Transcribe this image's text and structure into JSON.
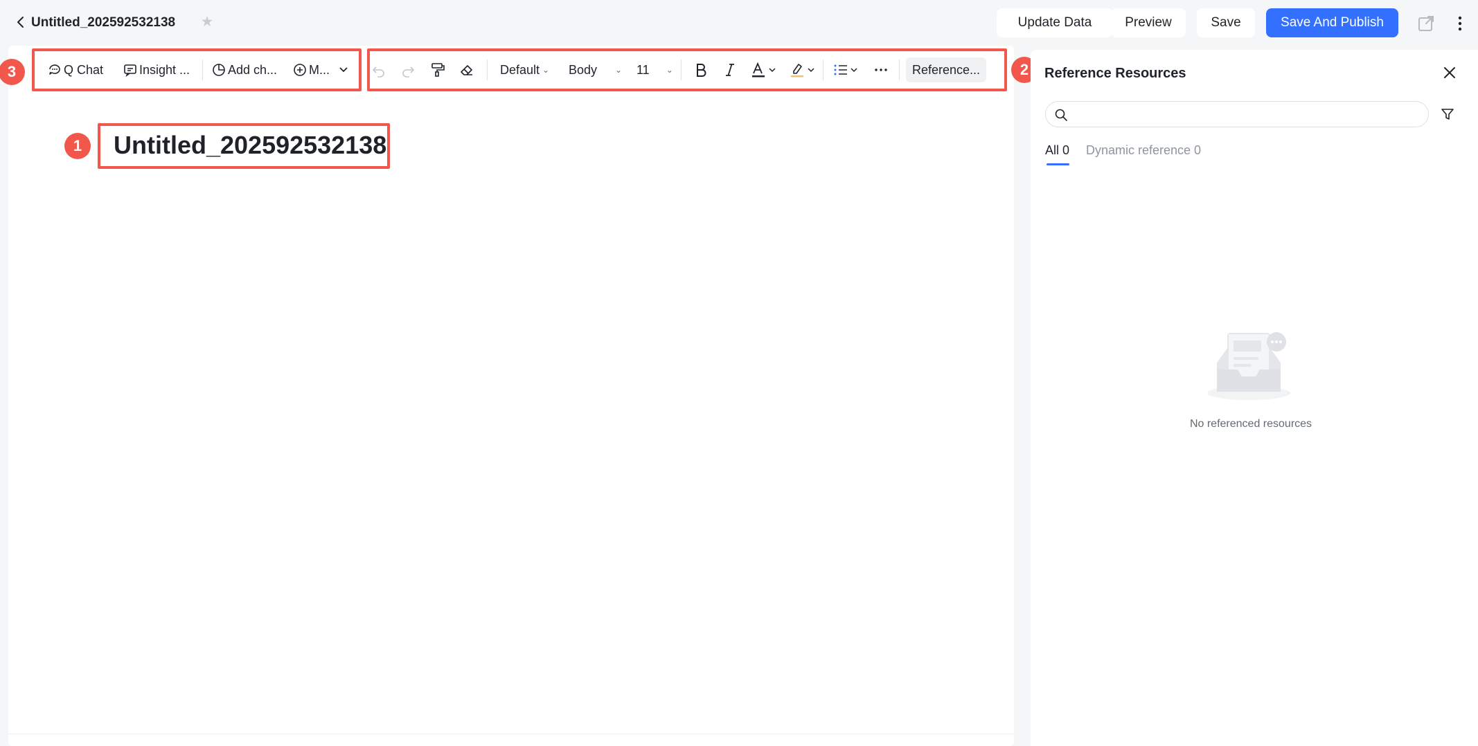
{
  "header": {
    "title": "Untitled_202592532138",
    "buttons": {
      "update_data": "Update Data",
      "preview": "Preview",
      "save": "Save",
      "save_publish": "Save And Publish"
    }
  },
  "toolbar": {
    "ai_group": {
      "q_chat": "Q Chat",
      "insight": "Insight ...",
      "add_chart": "Add ch...",
      "more": "M..."
    },
    "format_group": {
      "font": "Default",
      "style": "Body",
      "size": "11",
      "reference": "Reference..."
    }
  },
  "editor": {
    "heading": "Untitled_202592532138"
  },
  "annotations": {
    "n1": "1",
    "n2": "2",
    "n3": "3"
  },
  "panel": {
    "title": "Reference Resources",
    "search_placeholder": "",
    "tabs": [
      {
        "label": "All 0"
      },
      {
        "label": "Dynamic reference 0"
      }
    ],
    "empty_text": "No referenced resources"
  },
  "colors": {
    "accent": "#3370ff",
    "annotation": "#f2574b"
  }
}
